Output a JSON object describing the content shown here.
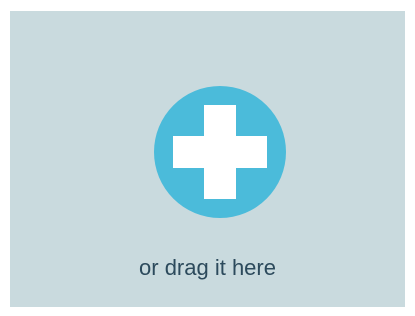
{
  "upload": {
    "icon": "plus-icon",
    "drag_hint": "or drag it here"
  },
  "colors": {
    "background": "#c9dade",
    "accent": "#4bbbda",
    "text": "#2c4a5c"
  }
}
